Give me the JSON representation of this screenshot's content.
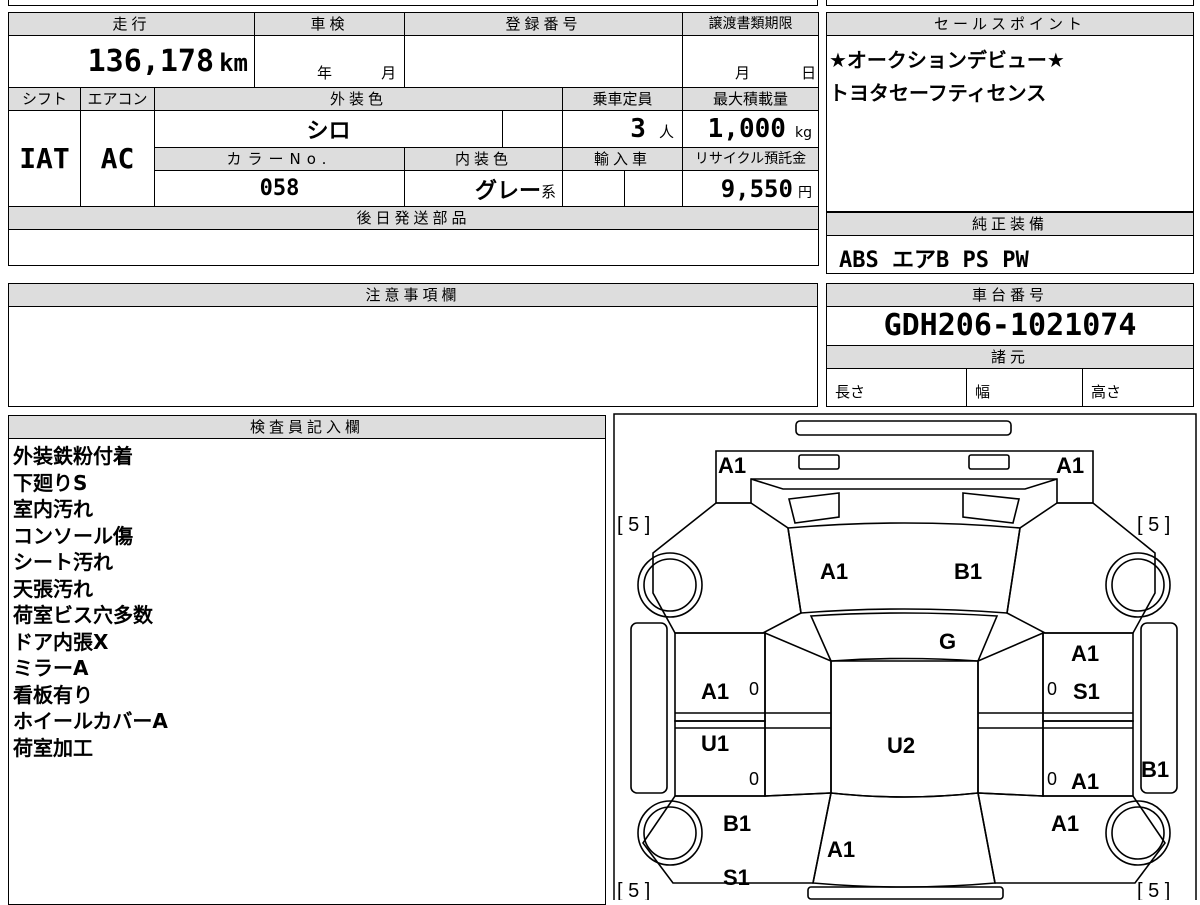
{
  "vehicle": {
    "mileage_label": "走行",
    "mileage_value": "136,178",
    "mileage_unit": "km",
    "inspection_label": "車検",
    "inspection_year_label": "年",
    "inspection_month_label": "月",
    "registration_label": "登録番号",
    "transfer_deadline_label": "譲渡書類期限",
    "transfer_month_label": "月",
    "transfer_day_label": "日",
    "shift_label": "シフト",
    "shift_value": "IAT",
    "aircon_label": "エアコン",
    "aircon_value": "AC",
    "exterior_color_label": "外装色",
    "exterior_color_value": "シロ",
    "capacity_label": "乗車定員",
    "capacity_value": "3",
    "capacity_unit": "人",
    "max_load_label": "最大積載量",
    "max_load_value": "1,000",
    "max_load_unit": "kg",
    "color_no_label": "カラーNo.",
    "color_no_value": "058",
    "interior_color_label": "内装色",
    "interior_color_value": "グレー",
    "interior_color_suffix": "系",
    "import_label": "輸入車",
    "recycle_label": "リサイクル預託金",
    "recycle_value": "9,550",
    "recycle_unit": "円",
    "later_parts_label": "後日発送部品",
    "notes_label": "注意事項欄",
    "inspector_label": "検査員記入欄"
  },
  "sales_points": {
    "label": "セールスポイント",
    "lines": [
      "★オークションデビュー★",
      "トヨタセーフティセンス"
    ]
  },
  "equipment": {
    "label": "純正装備",
    "value": "ABS エアB PS PW"
  },
  "chassis": {
    "label": "車台番号",
    "value": "GDH206-1021074",
    "spec_label": "諸元",
    "length_label": "長さ",
    "width_label": "幅",
    "height_label": "高さ"
  },
  "inspector_notes": [
    "外装鉄粉付着",
    "下廻りS",
    "室内汚れ",
    "コンソール傷",
    "シート汚れ",
    "天張汚れ",
    "荷室ビス穴多数",
    "ドア内張X",
    "ミラーA",
    "看板有り",
    "ホイールカバーA",
    "荷室加工"
  ],
  "damage_map": {
    "front_left": "A1",
    "front_right": "A1",
    "tire_front_left": "[ 5 ]",
    "tire_front_right": "[ 5 ]",
    "tire_rear_left": "[ 5 ]",
    "tire_rear_right": "[ 5 ]",
    "hood_left": "A1",
    "hood_right": "B1",
    "windshield": "G",
    "left_front_door": "A1",
    "left_front_door_zero": "0",
    "right_front_door_a": "A1",
    "right_front_door_s": "S1",
    "right_front_door_zero": "0",
    "left_rear_door": "U1",
    "left_rear_door_zero": "0",
    "right_rear_door": "A1",
    "right_rear_door_zero": "0",
    "roof": "U2",
    "right_side_panel": "B1",
    "left_rear_fender": "B1",
    "right_rear_fender": "A1",
    "rear_panel": "A1",
    "left_rear_bottom": "S1"
  }
}
